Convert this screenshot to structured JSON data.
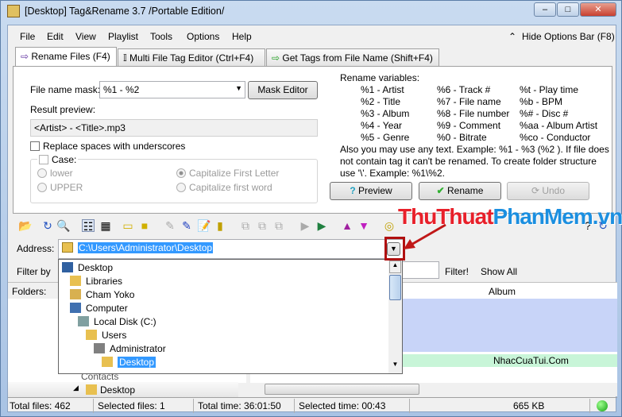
{
  "window": {
    "title": "[Desktop] Tag&Rename 3.7 /Portable Edition/",
    "min": "–",
    "max": "□",
    "close": "✕"
  },
  "menu": [
    "File",
    "Edit",
    "View",
    "Playlist",
    "Tools",
    "Options",
    "Help"
  ],
  "hide_options": "Hide Options Bar (F8)",
  "tabs": [
    "Rename Files (F4)",
    "Multi File Tag Editor (Ctrl+F4)",
    "Get Tags from File Name (Shift+F4)"
  ],
  "rename": {
    "mask_label": "File name mask:",
    "mask_value": "%1 - %2",
    "mask_editor": "Mask Editor",
    "result_label": "Result preview:",
    "result_value": "<Artist> - <Title>.mp3",
    "replace_spaces": "Replace spaces with underscores",
    "case_label": "Case:",
    "case_options": [
      "lower",
      "UPPER",
      "Capitalize First Letter",
      "Capitalize first word"
    ]
  },
  "variables": {
    "heading": "Rename variables:",
    "col1": [
      "%1 - Artist",
      "%2 - Title",
      "%3 - Album",
      "%4 - Year",
      "%5 - Genre"
    ],
    "col2": [
      "%6 - Track #",
      "%7 - File name",
      "%8 - File number",
      "%9 - Comment",
      "%0 - Bitrate"
    ],
    "col3": [
      "%t - Play time",
      "%b - BPM",
      "%# - Disc #",
      "%aa - Album Artist",
      "%co - Conductor"
    ],
    "note": "Also you may use any text. Example: %1 - %3 (%2 ). If file does not contain tag it can't be renamed. To create folder structure use '\\'. Example: %1\\%2."
  },
  "buttons": {
    "preview": "Preview",
    "rename": "Rename",
    "undo": "Undo"
  },
  "address": {
    "label": "Address:",
    "value": "C:\\Users\\Administrator\\Desktop"
  },
  "filter": {
    "label": "Filter by",
    "filter_btn": "Filter!",
    "show_all": "Show All"
  },
  "folders_label": "Folders:",
  "dropdown_items": [
    "Desktop",
    "Libraries",
    "Cham Yoko",
    "Computer",
    "Local Disk (C:)",
    "Users",
    "Administrator",
    "Desktop"
  ],
  "tree_bottom": {
    "partial": "Contacts",
    "item": "Desktop"
  },
  "list": {
    "column": "Album",
    "album_value": "NhacCuaTui.Com"
  },
  "status": {
    "total_files": "Total files: 462",
    "selected_files": "Selected files: 1",
    "total_time": "Total time: 36:01:50",
    "selected_time": "Selected time: 00:43",
    "size": "665 KB"
  },
  "watermark": {
    "part1": "ThuThuat",
    "part2": "PhanMem.vn"
  },
  "colors": {
    "selection": "#3399ff",
    "watermark_red": "#e8202a",
    "watermark_blue": "#1b8fe0",
    "highlight_box": "#b01010",
    "row_blue": "#c8d4f8",
    "row_green": "#c8f5d8"
  }
}
